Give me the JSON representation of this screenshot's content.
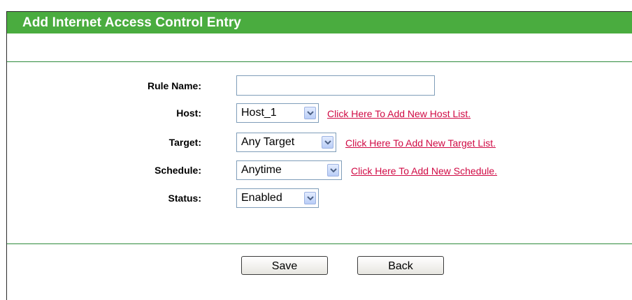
{
  "page": {
    "title": "Add Internet Access Control Entry"
  },
  "form": {
    "rule_name": {
      "label": "Rule Name:",
      "value": ""
    },
    "host": {
      "label": "Host:",
      "selected": "Host_1",
      "link": "Click Here To Add New Host List."
    },
    "target": {
      "label": "Target:",
      "selected": "Any Target",
      "link": "Click Here To Add New Target List."
    },
    "schedule": {
      "label": "Schedule:",
      "selected": "Anytime",
      "link": "Click Here To Add New Schedule."
    },
    "status": {
      "label": "Status:",
      "selected": "Enabled"
    }
  },
  "buttons": {
    "save": "Save",
    "back": "Back"
  },
  "colors": {
    "header_green": "#4aac3f",
    "link_red": "#d00a44",
    "rule_green": "#2e8b3c"
  },
  "icons": {
    "dropdown": "chevron-down-icon"
  }
}
